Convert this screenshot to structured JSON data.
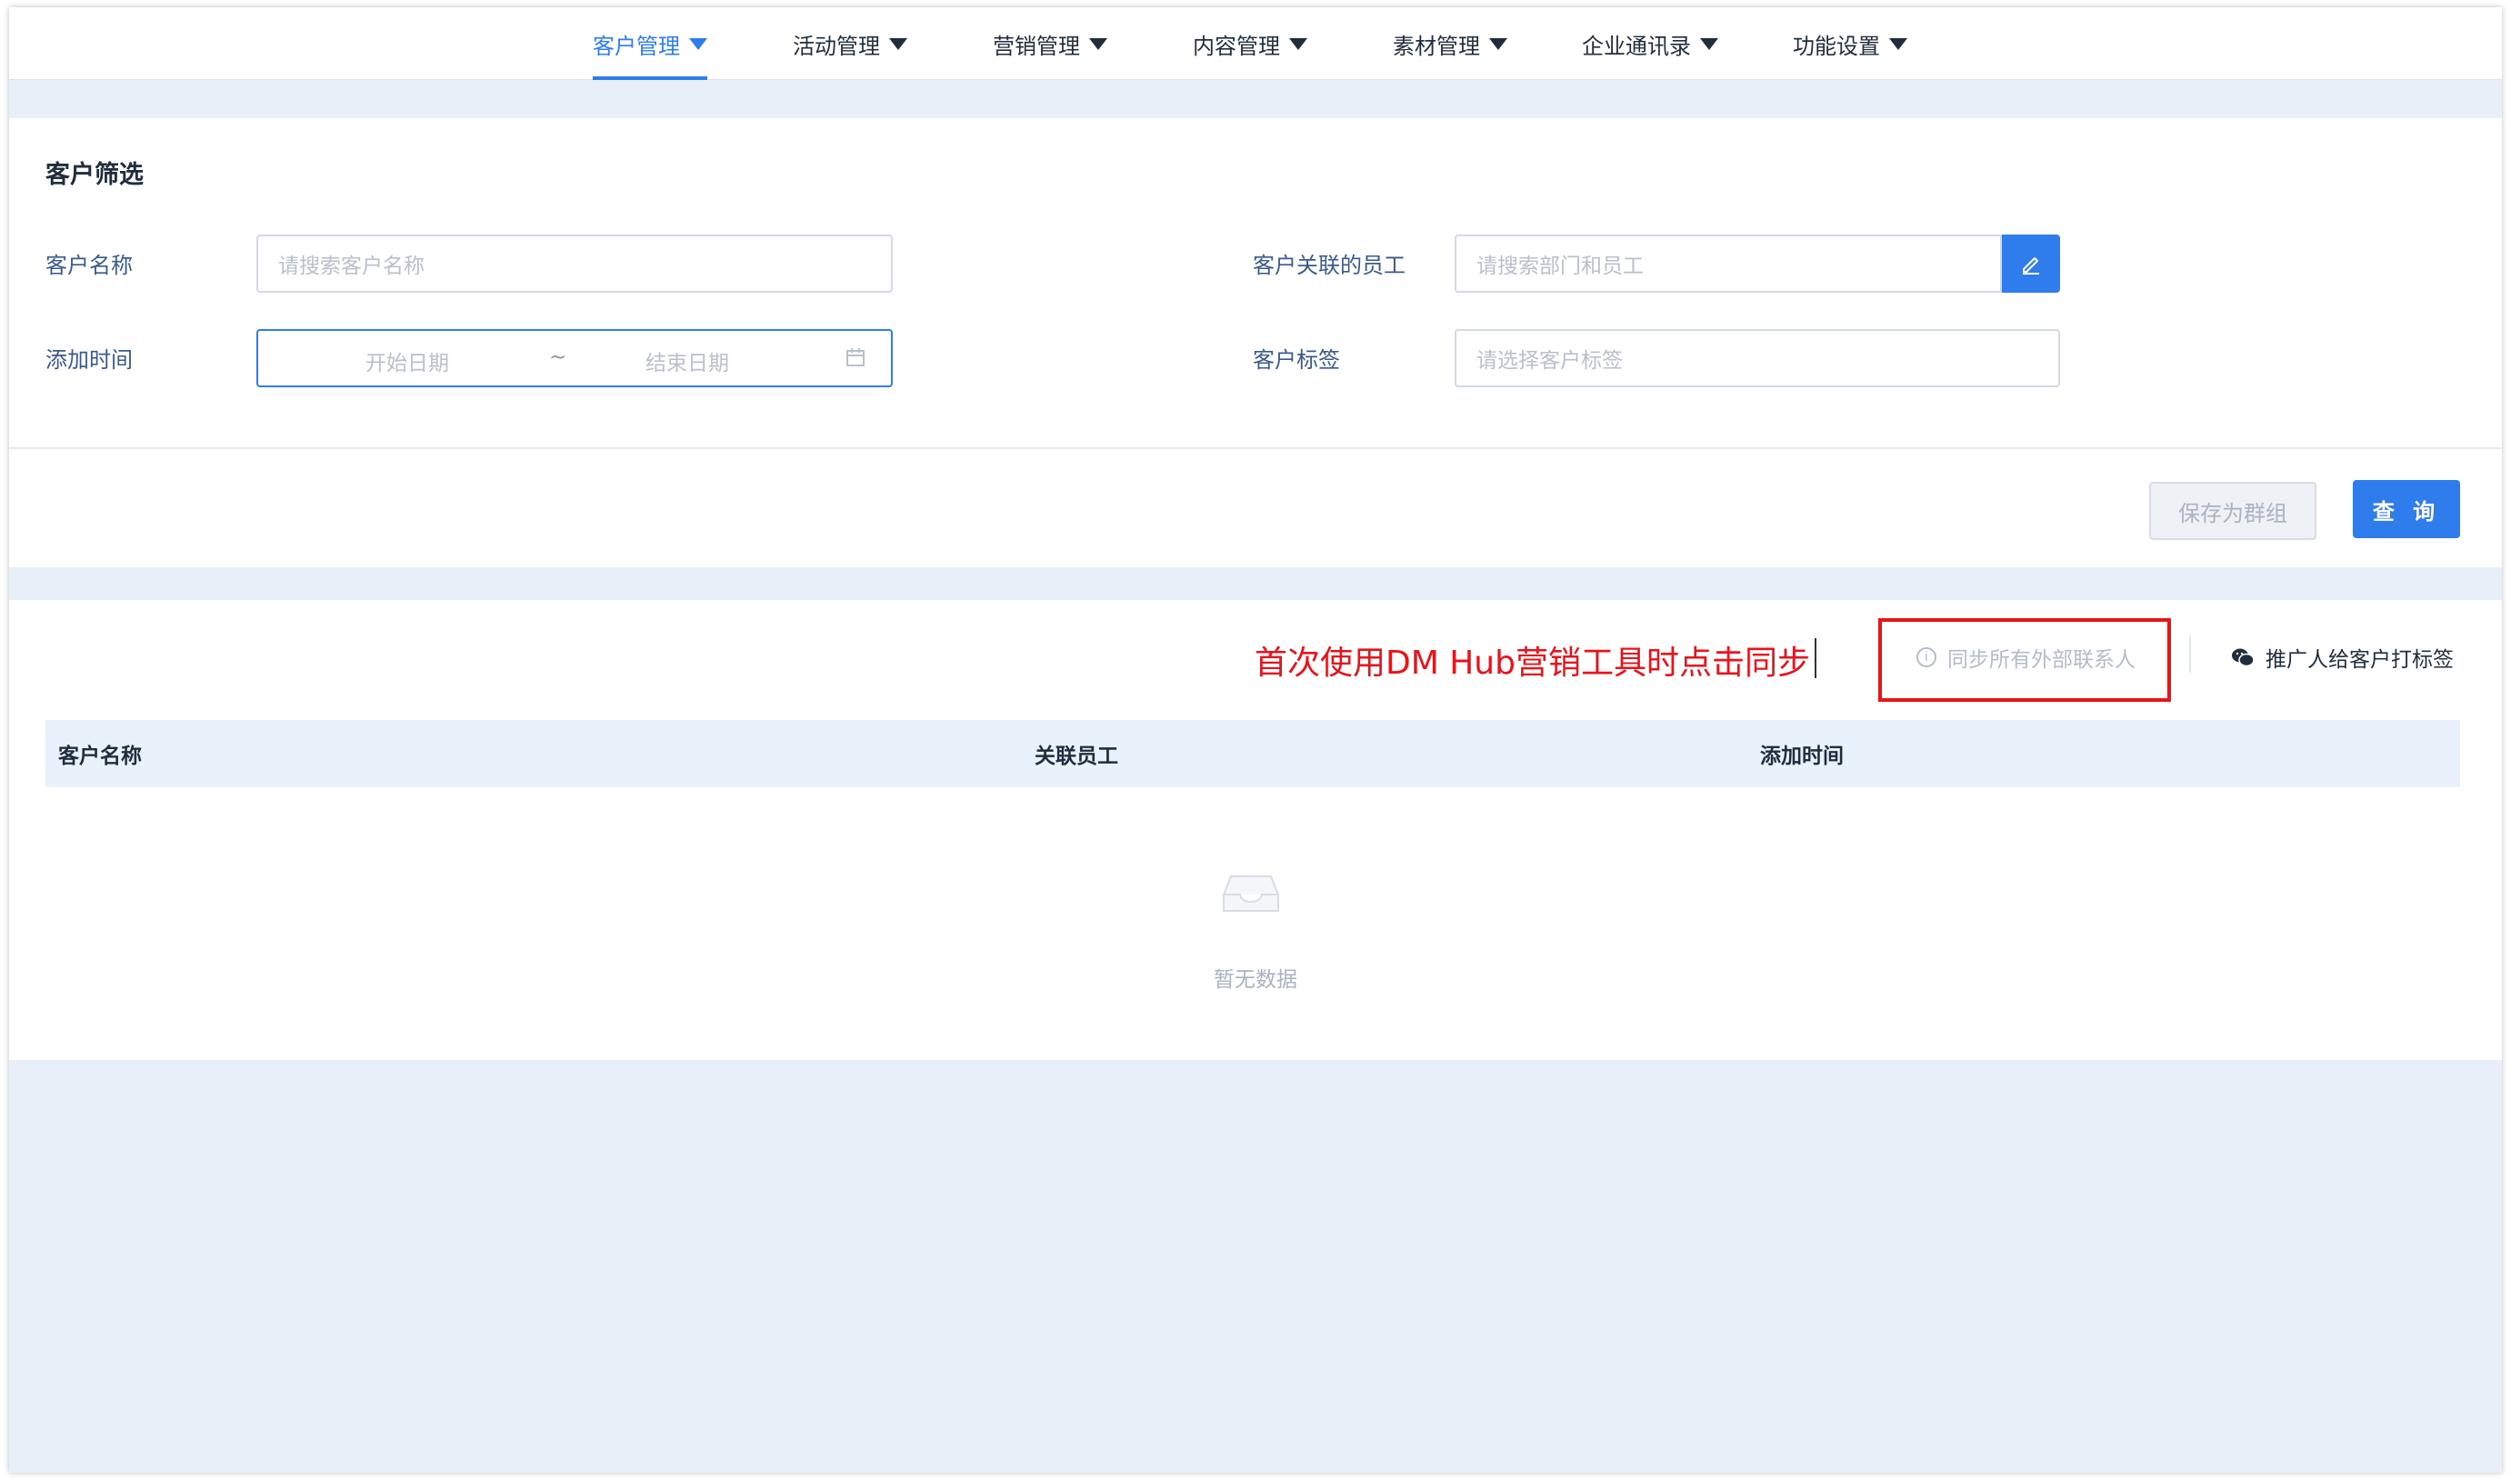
{
  "nav": {
    "items": [
      {
        "label": "客户管理"
      },
      {
        "label": "活动管理"
      },
      {
        "label": "营销管理"
      },
      {
        "label": "内容管理"
      },
      {
        "label": "素材管理"
      },
      {
        "label": "企业通讯录"
      },
      {
        "label": "功能设置"
      }
    ],
    "active_index": 0
  },
  "filter": {
    "title": "客户筛选",
    "customer_name_label": "客户名称",
    "customer_name_placeholder": "请搜索客户名称",
    "add_time_label": "添加时间",
    "start_date_placeholder": "开始日期",
    "date_separator": "~",
    "end_date_placeholder": "结束日期",
    "employee_label": "客户关联的员工",
    "employee_placeholder": "请搜索部门和员工",
    "tag_label": "客户标签",
    "tag_placeholder": "请选择客户标签",
    "save_group_label": "保存为群组",
    "query_label": "查 询"
  },
  "list": {
    "annotation": "首次使用DM Hub营销工具时点击同步",
    "sync_label": "同步所有外部联系人",
    "promote_tag_label": "推广人给客户打标签",
    "columns": [
      "客户名称",
      "关联员工",
      "添加时间"
    ],
    "empty_text": "暂无数据"
  },
  "colors": {
    "accent": "#2f7ded",
    "annotation": "#e8141c",
    "page_bg": "#e8eff9"
  }
}
